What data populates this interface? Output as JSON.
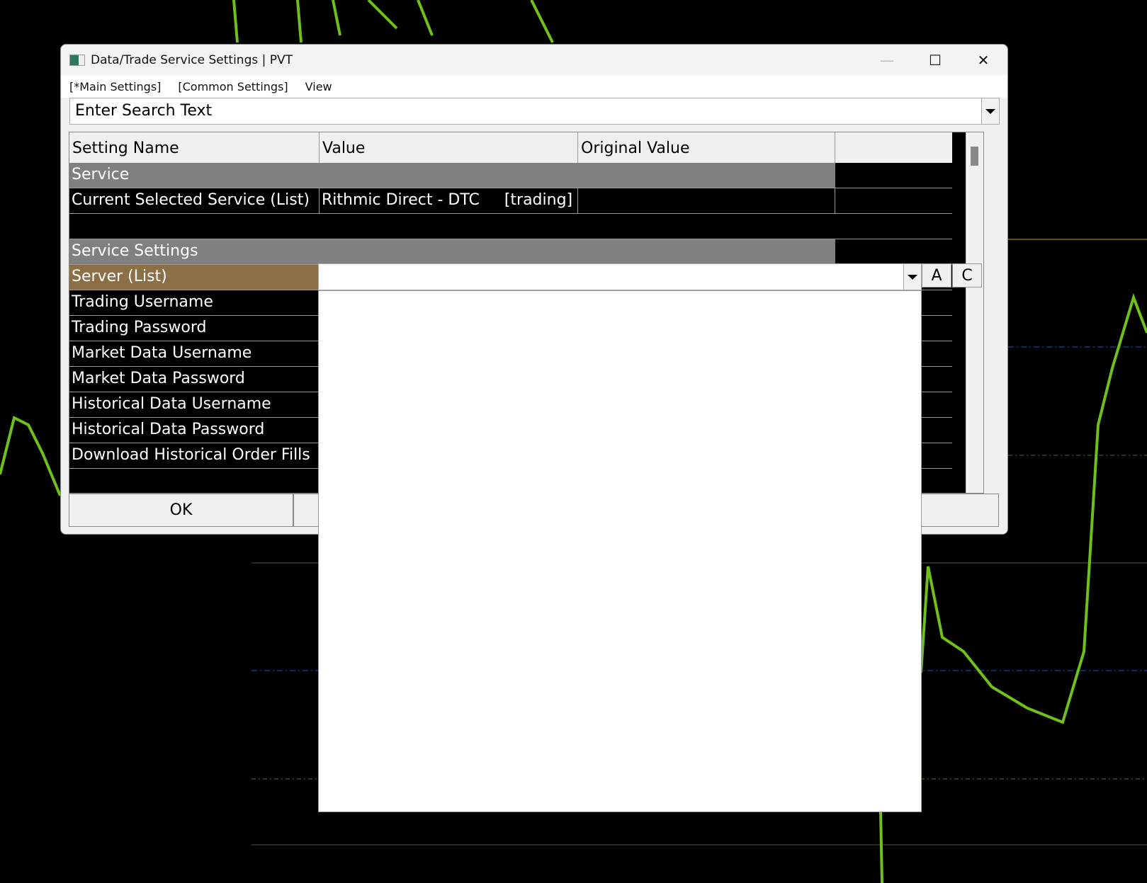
{
  "window": {
    "title": "Data/Trade Service Settings | PVT",
    "minimize": "—",
    "maximize": "☐",
    "close": "✕"
  },
  "menu": [
    "[*Main Settings]",
    "[Common Settings]",
    "View"
  ],
  "search": {
    "placeholder": "Enter Search Text"
  },
  "columns": [
    "Setting Name",
    "Value",
    "Original Value",
    ""
  ],
  "rows": [
    {
      "type": "section",
      "name": "Service"
    },
    {
      "type": "item",
      "name": "Current Selected Service (List)",
      "value": "Rithmic Direct - DTC     [trading]",
      "original": ""
    },
    {
      "type": "blank"
    },
    {
      "type": "section",
      "name": "Service Settings"
    },
    {
      "type": "selected",
      "name": "Server (List)"
    },
    {
      "type": "item",
      "name": "Trading Username"
    },
    {
      "type": "item",
      "name": "Trading Password"
    },
    {
      "type": "item",
      "name": "Market Data Username"
    },
    {
      "type": "item",
      "name": "Market Data Password"
    },
    {
      "type": "item",
      "name": "Historical Data Username"
    },
    {
      "type": "item",
      "name": "Historical Data Password"
    },
    {
      "type": "item",
      "name": "Download Historical Order Fills"
    }
  ],
  "buttons": {
    "ok": "OK",
    "a": "A",
    "c": "C"
  },
  "colors": {
    "section": "#808080",
    "selected": "#8b6f47",
    "bull": "#6fc01a"
  }
}
